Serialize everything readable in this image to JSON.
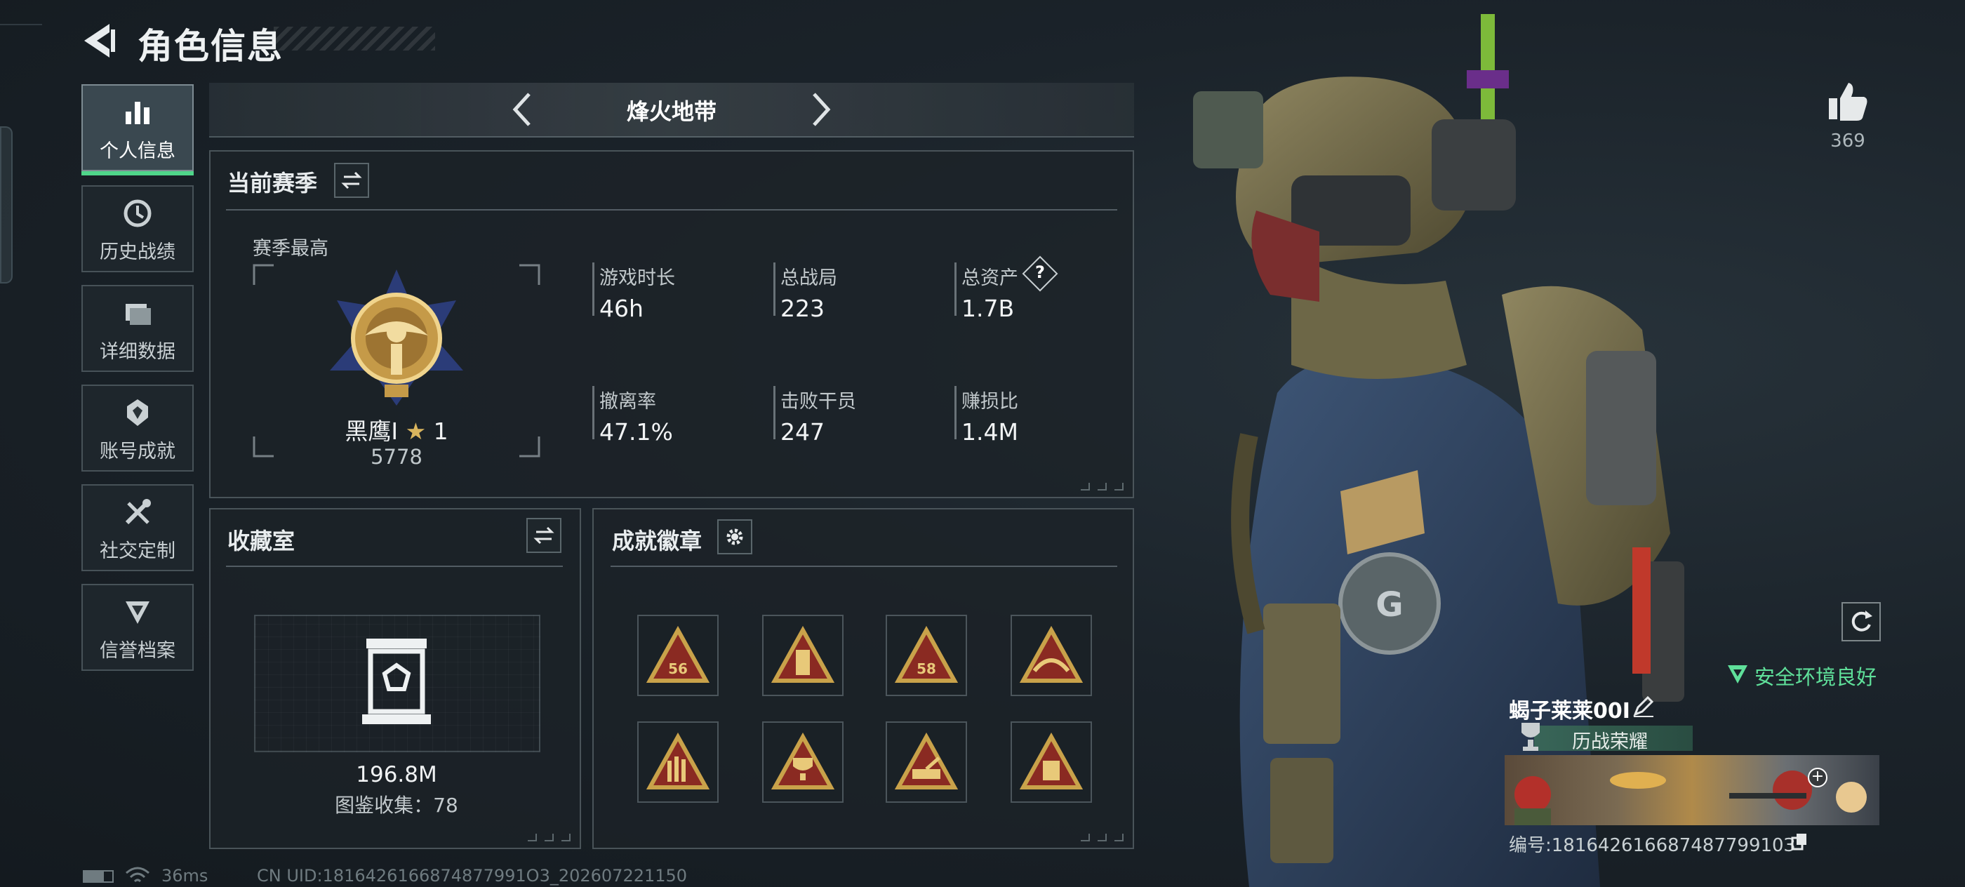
{
  "header": {
    "title": "角色信息"
  },
  "sidebar": {
    "items": [
      {
        "label": "个人信息",
        "icon": "bar-chart-icon",
        "active": true
      },
      {
        "label": "历史战绩",
        "icon": "clock-icon",
        "active": false
      },
      {
        "label": "详细数据",
        "icon": "folder-icon",
        "active": false
      },
      {
        "label": "账号成就",
        "icon": "achievement-icon",
        "active": false
      },
      {
        "label": "社交定制",
        "icon": "tools-icon",
        "active": false
      },
      {
        "label": "信誉档案",
        "icon": "shield-icon",
        "active": false
      }
    ]
  },
  "mode": {
    "title": "烽火地带"
  },
  "season": {
    "title": "当前赛季",
    "best_label": "赛季最高",
    "rank_name": "黑鹰Ⅰ",
    "rank_stars": "1",
    "rank_score": "5778",
    "stats": [
      {
        "label": "游戏时长",
        "value": "46h"
      },
      {
        "label": "总战局",
        "value": "223"
      },
      {
        "label": "总资产",
        "value": "1.7B",
        "help": "?"
      },
      {
        "label": "撤离率",
        "value": "47.1%"
      },
      {
        "label": "击败干员",
        "value": "247"
      },
      {
        "label": "赚损比",
        "value": "1.4M"
      }
    ]
  },
  "collection": {
    "title": "收藏室",
    "value": "196.8M",
    "count_text": "图鉴收集：78"
  },
  "badges": {
    "title": "成就徽章",
    "items": [
      {
        "icon": "badge-56-icon",
        "label": "56"
      },
      {
        "icon": "badge-tower-icon",
        "label": ""
      },
      {
        "icon": "badge-58-icon",
        "label": "58"
      },
      {
        "icon": "badge-bridge-icon",
        "label": ""
      },
      {
        "icon": "badge-hand-icon",
        "label": ""
      },
      {
        "icon": "badge-trophy-icon",
        "label": ""
      },
      {
        "icon": "badge-tank-icon",
        "label": ""
      },
      {
        "icon": "badge-box-icon",
        "label": ""
      }
    ]
  },
  "profile": {
    "likes": "369",
    "safety_text": "安全环境良好",
    "player_name": "蝎子莱莱00I",
    "honor_label": "历战荣耀",
    "id_text": "编号:18164261668748779910З"
  },
  "footer": {
    "ping": "36ms",
    "uid_text": "CN UID:1816426166874877991O3_202607221150"
  },
  "colors": {
    "accent_green": "#4fd68a",
    "safe_green": "#5fe09a",
    "badge_gold": "#c9a24a",
    "badge_red": "#8a2a22"
  }
}
